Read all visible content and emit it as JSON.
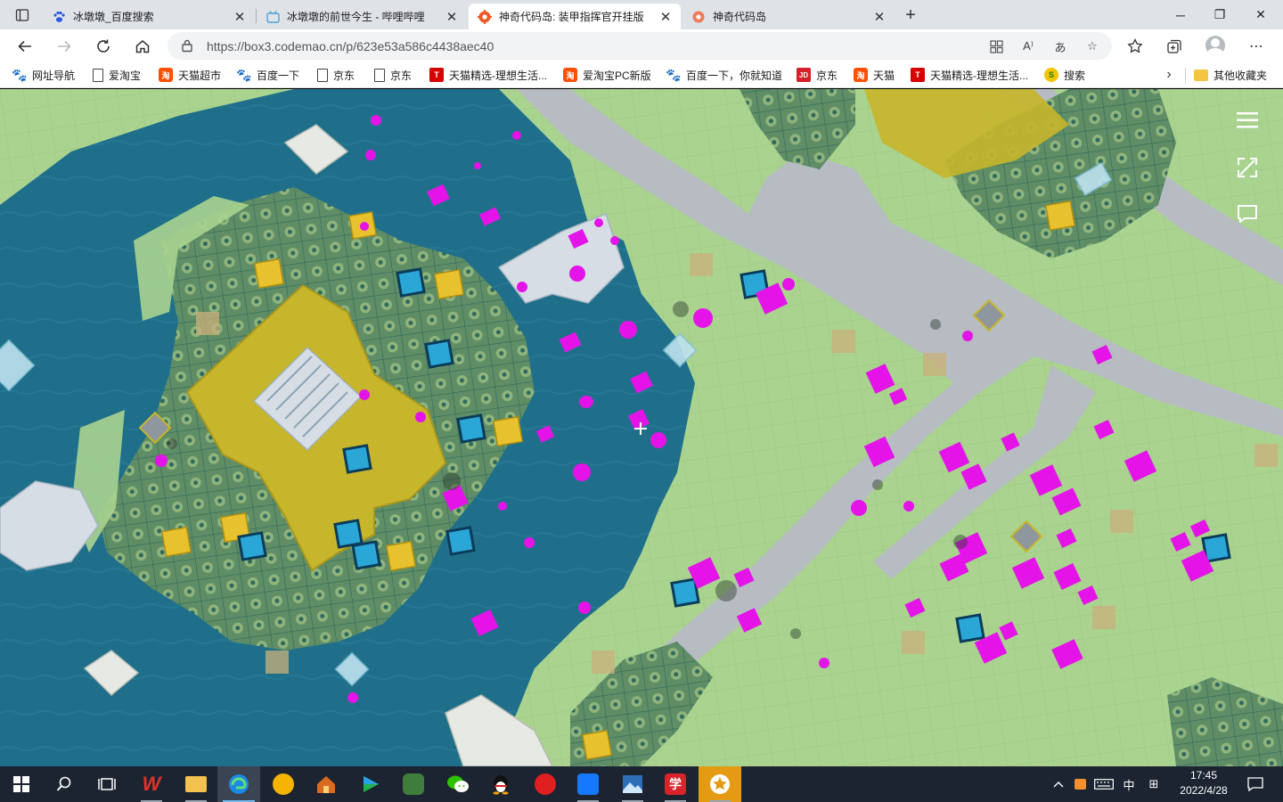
{
  "browser": {
    "tabs": [
      {
        "title": "冰墩墩_百度搜索",
        "favicon": "baidu-paw-icon",
        "active": false
      },
      {
        "title": "冰墩墩的前世今生 - 哔哩哔哩",
        "favicon": "bilibili-tv-icon",
        "active": false
      },
      {
        "title": "神奇代码岛: 装甲指挥官开挂版",
        "favicon": "codemao-gear-icon",
        "active": true
      },
      {
        "title": "神奇代码岛",
        "favicon": "codemao-gear-icon",
        "active": false
      }
    ],
    "new_tab_label": "+",
    "window_buttons": {
      "minimize": "─",
      "restore": "❐",
      "close": "✕"
    }
  },
  "address_bar": {
    "url": "https://box3.codemao.cn/p/623e53a586c4438aec40"
  },
  "favorites": [
    {
      "label": "网址导航",
      "icon": "baidu-paw-icon"
    },
    {
      "label": "爱淘宝",
      "icon": "page-icon"
    },
    {
      "label": "天猫超市",
      "icon": "taobao-icon"
    },
    {
      "label": "百度一下",
      "icon": "baidu-paw-icon"
    },
    {
      "label": "京东",
      "icon": "page-icon"
    },
    {
      "label": "京东",
      "icon": "page-icon"
    },
    {
      "label": "天猫精选-理想生活...",
      "icon": "tmall-icon"
    },
    {
      "label": "爱淘宝PC新版",
      "icon": "taobao-icon"
    },
    {
      "label": "百度一下，你就知道",
      "icon": "baidu-paw-icon"
    },
    {
      "label": "京东",
      "icon": "jd-icon"
    },
    {
      "label": "天猫",
      "icon": "taobao-icon"
    },
    {
      "label": "天猫精选-理想生活...",
      "icon": "tmall-icon"
    },
    {
      "label": "搜索",
      "icon": "sogou-icon"
    }
  ],
  "favorites_more": "›",
  "other_favorites": "其他收藏夹",
  "favorite_badges": {
    "taobao": "淘",
    "tmall": "T",
    "jd": "JD",
    "sogou": "S"
  },
  "taskbar": {
    "apps": [
      {
        "name": "wps",
        "label": "W",
        "color": "#e0322b"
      },
      {
        "name": "file-explorer",
        "label": "",
        "color": "#f2c14e"
      },
      {
        "name": "edge",
        "label": "",
        "color": "#1e88e5"
      },
      {
        "name": "game-tiger",
        "label": "",
        "color": "#f5b400"
      },
      {
        "name": "house-app",
        "label": "",
        "color": "#d96a1e"
      },
      {
        "name": "video-player",
        "label": "",
        "color": "#23b14d"
      },
      {
        "name": "panda-app",
        "label": "",
        "color": "#3f7d3a"
      },
      {
        "name": "wechat",
        "label": "",
        "color": "#2dc100"
      },
      {
        "name": "qq",
        "label": "",
        "color": "#111111"
      },
      {
        "name": "netease-music",
        "label": "",
        "color": "#e02020"
      },
      {
        "name": "blue-arrow-app",
        "label": "",
        "color": "#1677ff"
      },
      {
        "name": "photos",
        "label": "",
        "color": "#2d6fb7"
      },
      {
        "name": "xuexi",
        "label": "学",
        "color": "#d8232a"
      },
      {
        "name": "star-app",
        "label": "",
        "color": "#e49b13"
      }
    ],
    "tray": {
      "ime": "中",
      "layout": "⊞"
    },
    "clock": {
      "time": "17:45",
      "date": "2022/4/28"
    }
  },
  "colors": {
    "grass": "#a9d38f",
    "water": "#1f6f8b",
    "road": "#b7bcc2",
    "stone": "#d6dde4",
    "yellow_block": "#c7b52b",
    "magenta_unit": "#e414e8",
    "taskbar": "#1c2431"
  }
}
